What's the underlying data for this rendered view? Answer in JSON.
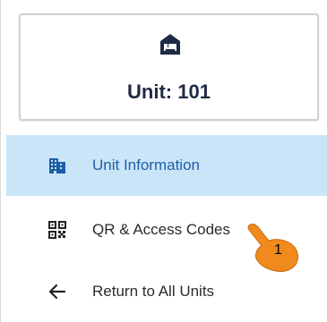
{
  "unit": {
    "icon": "hotel-bed-icon",
    "title": "Unit: 101"
  },
  "nav": {
    "items": [
      {
        "label": "Unit Information",
        "icon": "building-icon",
        "active": true
      },
      {
        "label": "QR & Access Codes",
        "icon": "qr-code-icon",
        "active": false
      },
      {
        "label": "Return to All Units",
        "icon": "arrow-left-icon",
        "active": false
      }
    ]
  },
  "annotation": {
    "step_number": "1",
    "pointer_icon": "hand-pointer-icon"
  },
  "colors": {
    "active_bg": "#cbe5f8",
    "active_text": "#1c5fa8",
    "unit_icon": "#1f2a44",
    "pointer": "#f08a1c"
  }
}
